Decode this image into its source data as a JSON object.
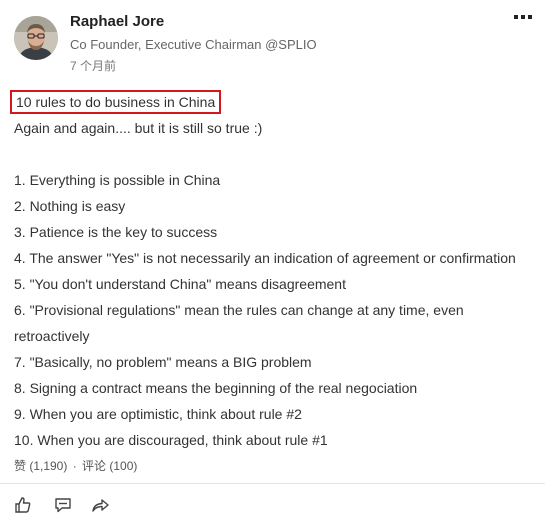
{
  "post": {
    "author": {
      "name": "Raphael Jore",
      "headline": "Co Founder, Executive Chairman @SPLIO",
      "time": "7 个月前"
    },
    "title": "10 rules to do business in China",
    "intro": "Again and again.... but it is still so true :)",
    "rules": [
      "1. Everything is possible in China",
      "2. Nothing is easy",
      "3. Patience is the key to success",
      "4. The answer \"Yes\" is not necessarily an indication of agreement or confirmation",
      "5. \"You don't understand China\" means disagreement",
      "6. \"Provisional regulations\" mean the rules can change at any time, even retroactively",
      "7. \"Basically, no problem\" means a BIG problem",
      "8. Signing a contract means the beginning of the real negociation",
      "9. When you are optimistic, think about rule #2",
      "10. When you are discouraged, think about rule #1"
    ],
    "likes_label": "赞 (1,190)",
    "separator": "·",
    "comments_label": "评论 (100)"
  },
  "icons": {
    "more": "more-dots-icon",
    "like": "thumbs-up-icon",
    "comment": "comment-icon",
    "share": "share-icon"
  },
  "colors": {
    "highlight_border": "#d4161d"
  }
}
